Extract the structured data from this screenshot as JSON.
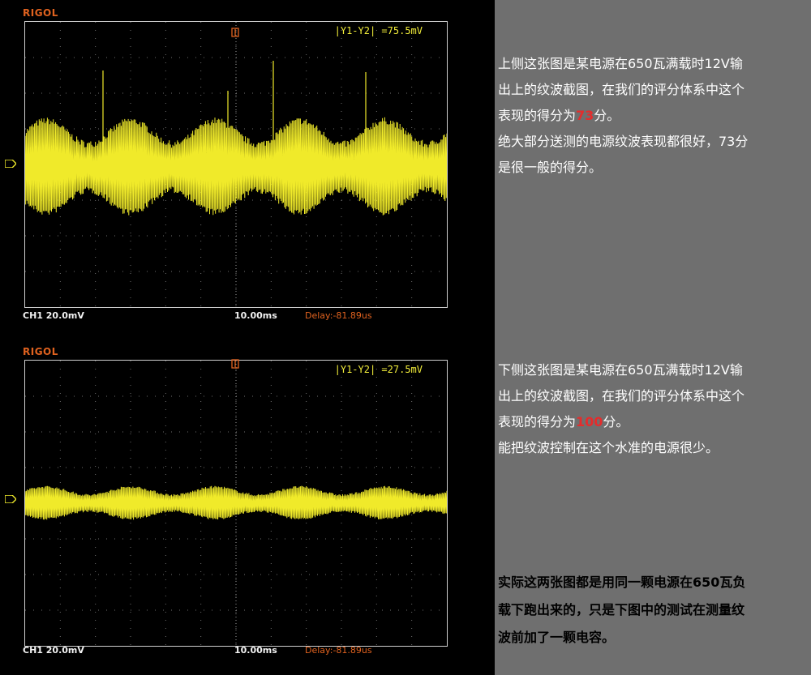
{
  "scopes": [
    {
      "brand": "RIGOL",
      "measurement": "|Y1-Y2| =75.5mV",
      "channel_scale": "CH1 20.0mV",
      "timebase": "10.00ms",
      "delay": "Delay:-81.89us"
    },
    {
      "brand": "RIGOL",
      "measurement": "|Y1-Y2| =27.5mV",
      "channel_scale": "CH1 20.0mV",
      "timebase": "10.00ms",
      "delay": "Delay:-81.89us"
    }
  ],
  "top_text": {
    "line1": "上侧这张图是某电源在650瓦满载时12V输",
    "line2": "出上的纹波截图，在我们的评分体系中这个",
    "line3_prefix": "表现的得分为",
    "score": "73",
    "line3_suffix": "分。",
    "line4": "绝大部分送测的电源纹波表现都很好，73分",
    "line5": "是很一般的得分。"
  },
  "bottom_text": {
    "line1": "下侧这张图是某电源在650瓦满载时12V输",
    "line2": "出上的纹波截图，在我们的评分体系中这个",
    "line3_prefix": "表现的得分为",
    "score": "100",
    "line3_suffix": "分。",
    "line4": "能把纹波控制在这个水准的电源很少。"
  },
  "note": {
    "line1": "实际这两张图都是用同一颗电源在650瓦负",
    "line2": "载下跑出来的，只是下图中的测试在测量纹",
    "line3": "波前加了一颗电容。"
  },
  "colors": {
    "trace": "#f0ea2a",
    "brand": "#e0621f",
    "score": "#e52c2c",
    "panel": "#6f6f6f"
  }
}
